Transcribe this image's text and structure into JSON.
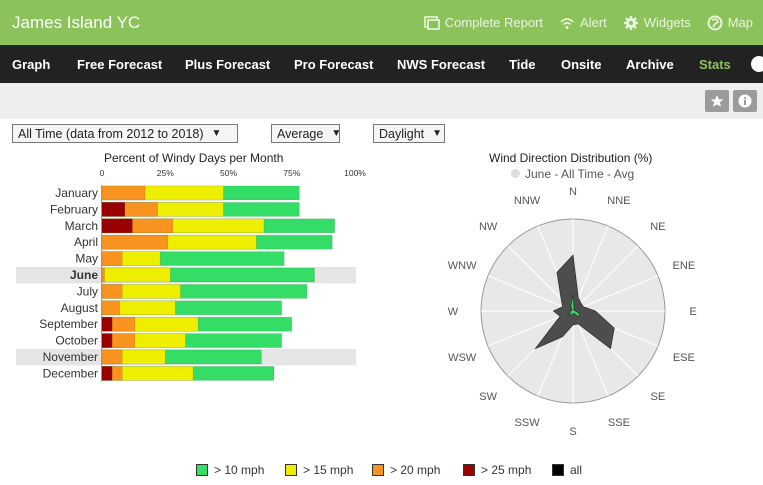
{
  "header": {
    "title": "James Island YC",
    "actions": [
      {
        "label": "Complete Report",
        "icon": "report-icon"
      },
      {
        "label": "Alert",
        "icon": "wifi-icon"
      },
      {
        "label": "Widgets",
        "icon": "gear-icon"
      },
      {
        "label": "Map",
        "icon": "globe-icon"
      }
    ]
  },
  "nav": {
    "items": [
      "Graph",
      "Free Forecast",
      "Plus Forecast",
      "Pro Forecast",
      "NWS Forecast",
      "Tide",
      "Onsite",
      "Archive",
      "Stats"
    ],
    "active": "Stats"
  },
  "filters": {
    "range": "All Time (data from 2012 to 2018)",
    "stat": "Average",
    "time": "Daylight"
  },
  "colors": {
    "gt10": "#33dd66",
    "gt15": "#eeee00",
    "gt20": "#f7931e",
    "gt25": "#990000",
    "all": "#000000",
    "accent": "#8cc25a"
  },
  "chart_data": [
    {
      "type": "bar",
      "title": "Percent of Windy Days per Month",
      "xlim": [
        0,
        100
      ],
      "ticks": [
        "0",
        "25%",
        "50%",
        "75%",
        "100%"
      ],
      "categories": [
        "January",
        "February",
        "March",
        "April",
        "May",
        "June",
        "July",
        "August",
        "September",
        "October",
        "November",
        "December"
      ],
      "highlighted": [
        "June",
        "November"
      ],
      "bold": "June",
      "series": [
        {
          "name": "> 10 mph",
          "values": [
            78,
            78,
            92,
            91,
            72,
            84,
            81,
            71,
            75,
            71,
            63,
            68
          ]
        },
        {
          "name": "> 15 mph",
          "values": [
            48,
            48,
            64,
            61,
            23,
            27,
            31,
            29,
            38,
            33,
            25,
            36
          ]
        },
        {
          "name": "> 20 mph",
          "values": [
            17,
            22,
            28,
            26,
            8,
            1,
            8,
            7,
            13,
            13,
            8,
            8
          ]
        },
        {
          "name": "> 25 mph",
          "values": [
            0,
            9,
            12,
            0,
            0,
            0,
            0,
            0,
            4,
            4,
            0,
            4
          ]
        }
      ]
    },
    {
      "type": "radar",
      "title": "Wind Direction Distribution (%)",
      "subtitle": "June - All Time - Avg",
      "directions": [
        "N",
        "NNE",
        "NE",
        "ENE",
        "E",
        "ESE",
        "SE",
        "SSE",
        "S",
        "SSW",
        "SW",
        "WSW",
        "W",
        "WNW",
        "NW",
        "NNW"
      ],
      "series": [
        {
          "name": "all",
          "values": [
            2,
            0.5,
            0.4,
            0.4,
            0.8,
            1.6,
            1.9,
            0.5,
            0.5,
            1.0,
            1.9,
            0.5,
            0.7,
            0.4,
            0.6,
            1.5
          ]
        },
        {
          "name": "> 10 mph",
          "values": [
            0.6,
            0.1,
            0.05,
            0.05,
            0.1,
            0.25,
            0.3,
            0.1,
            0.1,
            0.15,
            0.2,
            0.1,
            0.1,
            0.05,
            0.05,
            0.2
          ]
        }
      ],
      "rmax": 3.3
    }
  ],
  "legend": [
    {
      "label": "> 10 mph",
      "color": "#33dd66"
    },
    {
      "label": "> 15 mph",
      "color": "#eeee00"
    },
    {
      "label": "> 20 mph",
      "color": "#f7931e"
    },
    {
      "label": "> 25 mph",
      "color": "#990000"
    },
    {
      "label": "all",
      "color": "#000000"
    }
  ]
}
